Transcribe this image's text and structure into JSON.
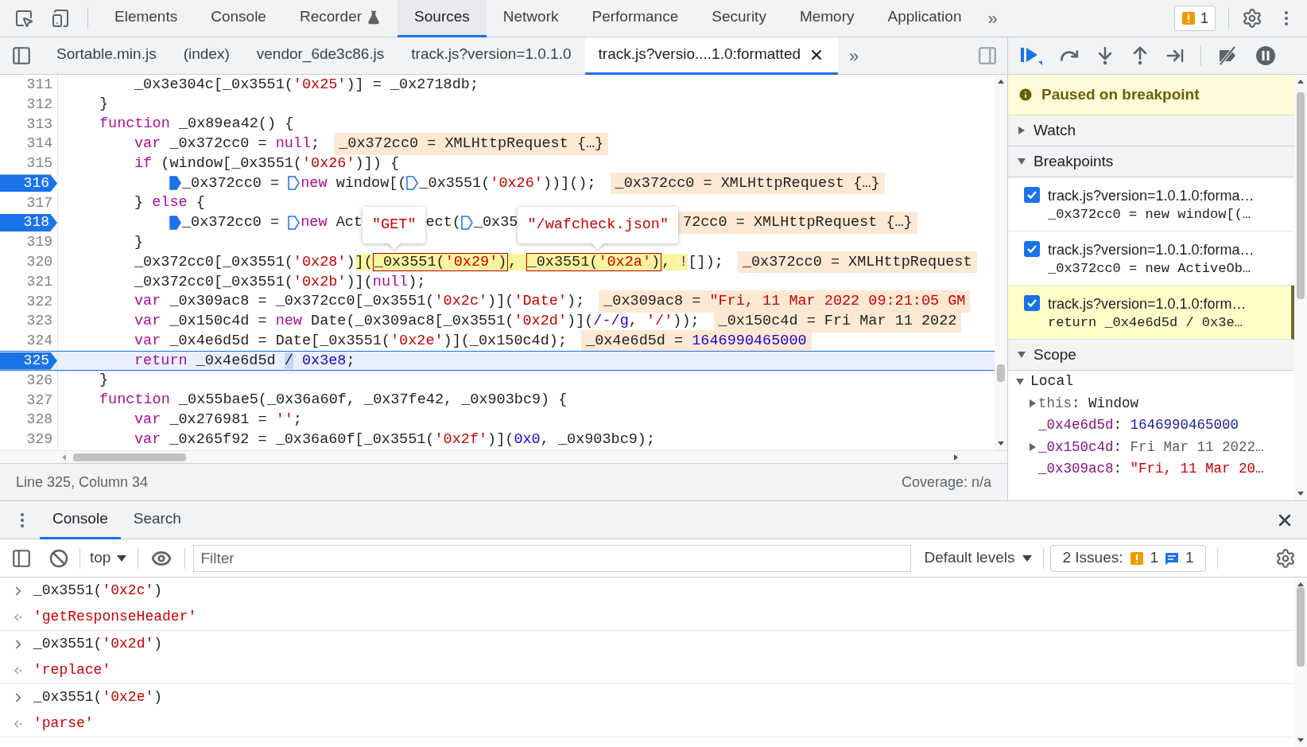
{
  "top_tabs": [
    {
      "label": "Elements",
      "selected": false,
      "experimental": false
    },
    {
      "label": "Console",
      "selected": false,
      "experimental": false
    },
    {
      "label": "Recorder",
      "selected": false,
      "experimental": true
    },
    {
      "label": "Sources",
      "selected": true,
      "experimental": false
    },
    {
      "label": "Network",
      "selected": false,
      "experimental": false
    },
    {
      "label": "Performance",
      "selected": false,
      "experimental": false
    },
    {
      "label": "Security",
      "selected": false,
      "experimental": false
    },
    {
      "label": "Memory",
      "selected": false,
      "experimental": false
    },
    {
      "label": "Application",
      "selected": false,
      "experimental": false
    }
  ],
  "more_tabs": "»",
  "issues_badge": "1",
  "file_tabs": [
    {
      "label": "Sortable.min.js",
      "selected": false,
      "closable": false
    },
    {
      "label": "(index)",
      "selected": false,
      "closable": false
    },
    {
      "label": "vendor_6de3c86.js",
      "selected": false,
      "closable": false
    },
    {
      "label": "track.js?version=1.0.1.0",
      "selected": false,
      "closable": false
    },
    {
      "label": "track.js?versio....1.0:formatted",
      "selected": true,
      "closable": true
    }
  ],
  "file_tabs_more": "»",
  "code": {
    "lines": [
      {
        "kind": "block",
        "children": [
          {
            "kind": "block",
            "children": [
              {
                "kind": "line",
                "number": "311",
                "breakpoint": false,
                "current": false,
                "segments": [
                  {
                    "kind": "code",
                    "tokens": [
                      {
                        "t": "_0x3e304c[_0x3551("
                      },
                      {
                        "t": "'0x25'",
                        "kind": "str"
                      },
                      {
                        "t": ")] = _0x2718db;"
                      }
                    ]
                  }
                ]
              }
            ]
          },
          {
            "kind": "line",
            "number": "312",
            "breakpoint": false,
            "current": false,
            "segments": [
              {
                "kind": "code",
                "tokens": [
                  {
                    "t": "}"
                  }
                ]
              }
            ]
          },
          {
            "kind": "line",
            "number": "313",
            "breakpoint": false,
            "current": false,
            "segments": [
              {
                "kind": "code",
                "tokens": [
                  {
                    "t": "function",
                    "kind": "kw"
                  },
                  {
                    "t": " _0x89ea42() {"
                  }
                ]
              }
            ],
            "children": [
              {
                "kind": "line",
                "number": "314",
                "breakpoint": false,
                "current": false,
                "segments": [
                  {
                    "kind": "code",
                    "tokens": [
                      {
                        "t": "var",
                        "kind": "kw"
                      },
                      {
                        "t": " _0x372cc0 = "
                      },
                      {
                        "t": "null",
                        "kind": "kw"
                      },
                      {
                        "t": ";"
                      }
                    ]
                  },
                  {
                    "kind": "inline",
                    "tokens": [
                      {
                        "t": "_0x372cc0 = XMLHttpRequest {…}"
                      }
                    ]
                  }
                ]
              },
              {
                "kind": "line",
                "number": "315",
                "breakpoint": false,
                "current": false,
                "segments": [
                  {
                    "kind": "code",
                    "tokens": [
                      {
                        "t": "if",
                        "kind": "kw"
                      },
                      {
                        "t": " (window[_0x3551("
                      },
                      {
                        "t": "'0x26'",
                        "kind": "str"
                      },
                      {
                        "t": ")]) {"
                      }
                    ]
                  }
                ],
                "children": [
                  {
                    "kind": "line",
                    "number": "316",
                    "breakpoint": true,
                    "current": false,
                    "segments": [
                      {
                        "kind": "marker",
                        "active": true
                      },
                      {
                        "kind": "code",
                        "tokens": [
                          {
                            "t": "_0x372cc0 = "
                          }
                        ]
                      },
                      {
                        "kind": "marker",
                        "active": false
                      },
                      {
                        "kind": "code",
                        "tokens": [
                          {
                            "t": "new",
                            "kind": "kw"
                          },
                          {
                            "t": " window[("
                          }
                        ]
                      },
                      {
                        "kind": "marker",
                        "active": false
                      },
                      {
                        "kind": "code",
                        "tokens": [
                          {
                            "t": "_0x3551("
                          },
                          {
                            "t": "'0x26'",
                            "kind": "str"
                          },
                          {
                            "t": "))]();"
                          }
                        ]
                      },
                      {
                        "kind": "inline",
                        "tokens": [
                          {
                            "t": "_0x372cc0 = XMLHttpRequest {…}"
                          }
                        ]
                      }
                    ]
                  }
                ]
              },
              {
                "kind": "line",
                "number": "317",
                "breakpoint": false,
                "current": false,
                "segments": [
                  {
                    "kind": "code",
                    "tokens": [
                      {
                        "t": "} "
                      },
                      {
                        "t": "else",
                        "kind": "kw"
                      },
                      {
                        "t": " {"
                      }
                    ]
                  }
                ],
                "children": [
                  {
                    "kind": "line",
                    "number": "318",
                    "breakpoint": true,
                    "current": false,
                    "segments": [
                      {
                        "kind": "marker",
                        "active": true
                      },
                      {
                        "kind": "code",
                        "tokens": [
                          {
                            "t": "_0x372cc0 = "
                          }
                        ]
                      },
                      {
                        "kind": "marker",
                        "active": false
                      },
                      {
                        "kind": "code",
                        "tokens": [
                          {
                            "t": "new",
                            "kind": "kw"
                          },
                          {
                            "t": " Act"
                          }
                        ]
                      },
                      {
                        "kind": "popover",
                        "text": "\"GET\""
                      },
                      {
                        "kind": "code",
                        "tokens": [
                          {
                            "t": "ect("
                          }
                        ]
                      },
                      {
                        "kind": "marker",
                        "active": false
                      },
                      {
                        "kind": "code",
                        "tokens": [
                          {
                            "t": "_0x35"
                          }
                        ]
                      },
                      {
                        "kind": "popover",
                        "text": "\"/wafcheck.json\""
                      },
                      {
                        "kind": "inline",
                        "tokens": [
                          {
                            "t": "72cc0 = XMLHttpRequest {…}"
                          }
                        ]
                      }
                    ]
                  }
                ]
              },
              {
                "kind": "line",
                "number": "319",
                "breakpoint": false,
                "current": false,
                "segments": [
                  {
                    "kind": "code",
                    "tokens": [
                      {
                        "t": "}"
                      }
                    ]
                  }
                ]
              },
              {
                "kind": "line",
                "number": "320",
                "breakpoint": false,
                "current": false,
                "segments": [
                  {
                    "kind": "code",
                    "tokens": [
                      {
                        "t": "_0x372cc0[_0x3551("
                      },
                      {
                        "t": "'0x28'",
                        "kind": "str"
                      },
                      {
                        "t": ")"
                      },
                      {
                        "t": "](",
                        "highlighted": true
                      },
                      {
                        "kind": "group",
                        "boxed": true,
                        "tokens": [
                          {
                            "t": "_0x3551("
                          },
                          {
                            "t": "'0x29'",
                            "kind": "str"
                          },
                          {
                            "t": ")"
                          }
                        ]
                      },
                      {
                        "t": ", ",
                        "highlighted": true
                      },
                      {
                        "kind": "group",
                        "boxed": true,
                        "tokens": [
                          {
                            "t": "_0x3551("
                          },
                          {
                            "t": "'0x2a'",
                            "kind": "str"
                          },
                          {
                            "t": ")"
                          }
                        ]
                      },
                      {
                        "t": ", ",
                        "highlighted": true
                      },
                      {
                        "t": "!",
                        "kind": "kw",
                        "highlighted": true
                      },
                      {
                        "t": "[]);"
                      }
                    ]
                  },
                  {
                    "kind": "inline",
                    "tokens": [
                      {
                        "t": "_0x372cc0 = XMLHttpRequest"
                      }
                    ]
                  }
                ]
              },
              {
                "kind": "line",
                "number": "321",
                "breakpoint": false,
                "current": false,
                "segments": [
                  {
                    "kind": "code",
                    "tokens": [
                      {
                        "t": "_0x372cc0[_0x3551("
                      },
                      {
                        "t": "'0x2b'",
                        "kind": "str"
                      },
                      {
                        "t": ")]("
                      },
                      {
                        "t": "null",
                        "kind": "kw"
                      },
                      {
                        "t": ");"
                      }
                    ]
                  }
                ]
              },
              {
                "kind": "line",
                "number": "322",
                "breakpoint": false,
                "current": false,
                "segments": [
                  {
                    "kind": "code",
                    "tokens": [
                      {
                        "t": "var",
                        "kind": "kw"
                      },
                      {
                        "t": " _0x309ac8 = _0x372cc0[_0x3551("
                      },
                      {
                        "t": "'0x2c'",
                        "kind": "str"
                      },
                      {
                        "t": ")]("
                      },
                      {
                        "t": "'Date'",
                        "kind": "str"
                      },
                      {
                        "t": ");"
                      }
                    ]
                  },
                  {
                    "kind": "inline",
                    "tokens": [
                      {
                        "t": "_0x309ac8 = "
                      },
                      {
                        "t": "\"Fri, 11 Mar 2022 09:21:05 GM",
                        "kind": "str"
                      }
                    ]
                  }
                ]
              },
              {
                "kind": "line",
                "number": "323",
                "breakpoint": false,
                "current": false,
                "segments": [
                  {
                    "kind": "code",
                    "tokens": [
                      {
                        "t": "var",
                        "kind": "kw"
                      },
                      {
                        "t": " _0x150c4d = "
                      },
                      {
                        "t": "new",
                        "kind": "kw"
                      },
                      {
                        "t": " Date(_0x309ac8[_0x3551("
                      },
                      {
                        "t": "'0x2d'",
                        "kind": "str"
                      },
                      {
                        "t": ")]("
                      },
                      {
                        "t": "/-/g",
                        "kind": "num"
                      },
                      {
                        "t": ", "
                      },
                      {
                        "t": "'/'",
                        "kind": "str"
                      },
                      {
                        "t": "));"
                      }
                    ]
                  },
                  {
                    "kind": "inline",
                    "tokens": [
                      {
                        "t": "_0x150c4d = Fri Mar 11 2022"
                      }
                    ]
                  }
                ]
              },
              {
                "kind": "line",
                "number": "324",
                "breakpoint": false,
                "current": false,
                "segments": [
                  {
                    "kind": "code",
                    "tokens": [
                      {
                        "t": "var",
                        "kind": "kw"
                      },
                      {
                        "t": " _0x4e6d5d = Date[_0x3551("
                      },
                      {
                        "t": "'0x2e'",
                        "kind": "str"
                      },
                      {
                        "t": ")](_0x150c4d);"
                      }
                    ]
                  },
                  {
                    "kind": "inline",
                    "tokens": [
                      {
                        "t": "_0x4e6d5d = "
                      },
                      {
                        "t": "1646990465000",
                        "kind": "num"
                      }
                    ]
                  }
                ]
              },
              {
                "kind": "line",
                "number": "325",
                "breakpoint": true,
                "current": true,
                "segments": [
                  {
                    "kind": "code",
                    "tokens": [
                      {
                        "t": "return",
                        "kind": "kw"
                      },
                      {
                        "t": " _0x4e6d5d "
                      },
                      {
                        "t": "/",
                        "caret": true
                      },
                      {
                        "t": " 0x3e8",
                        "kind": "num"
                      },
                      {
                        "t": ";"
                      }
                    ]
                  }
                ]
              }
            ]
          },
          {
            "kind": "line",
            "number": "326",
            "breakpoint": false,
            "current": false,
            "segments": [
              {
                "kind": "code",
                "tokens": [
                  {
                    "t": "}"
                  }
                ]
              }
            ]
          },
          {
            "kind": "line",
            "number": "327",
            "breakpoint": false,
            "current": false,
            "segments": [
              {
                "kind": "code",
                "tokens": [
                  {
                    "t": "function",
                    "kind": "kw"
                  },
                  {
                    "t": " _0x55bae5(_0x36a60f, _0x37fe42, _0x903bc9) {"
                  }
                ]
              }
            ],
            "children": [
              {
                "kind": "line",
                "number": "328",
                "breakpoint": false,
                "current": false,
                "segments": [
                  {
                    "kind": "code",
                    "tokens": [
                      {
                        "t": "var",
                        "kind": "kw"
                      },
                      {
                        "t": " _0x276981 = "
                      },
                      {
                        "t": "''",
                        "kind": "str"
                      },
                      {
                        "t": ";"
                      }
                    ]
                  }
                ]
              },
              {
                "kind": "line",
                "number": "329",
                "breakpoint": false,
                "current": false,
                "segments": [
                  {
                    "kind": "code",
                    "tokens": [
                      {
                        "t": "var",
                        "kind": "kw"
                      },
                      {
                        "t": " _0x265f92 = _0x36a60f[_0x3551("
                      },
                      {
                        "t": "'0x2f'",
                        "kind": "str"
                      },
                      {
                        "t": ")]("
                      },
                      {
                        "t": "0x0",
                        "kind": "num"
                      },
                      {
                        "t": ", _0x903bc9);"
                      }
                    ]
                  }
                ]
              }
            ]
          }
        ]
      }
    ]
  },
  "status": {
    "position": "Line 325, Column 34",
    "coverage": "Coverage: n/a"
  },
  "debugger": {
    "paused_message": "Paused on breakpoint",
    "sections": [
      {
        "kind": "watch",
        "title": "Watch",
        "expanded": false
      },
      {
        "kind": "breakpoints",
        "title": "Breakpoints",
        "expanded": true,
        "items": [
          {
            "file": "track.js?version=1.0.1.0:forma…",
            "code": "_0x372cc0 = new window[(…",
            "checked": true,
            "selected": false
          },
          {
            "file": "track.js?version=1.0.1.0:forma…",
            "code": "_0x372cc0 = new ActiveOb…",
            "checked": true,
            "selected": false
          },
          {
            "file": "track.js?version=1.0.1.0:form…",
            "code": "return _0x4e6d5d / 0x3e…",
            "checked": true,
            "selected": true
          }
        ]
      },
      {
        "kind": "scope",
        "title": "Scope",
        "expanded": true,
        "scopes": [
          {
            "title": "Local",
            "expanded": true,
            "children": [
              {
                "name": "this",
                "separator": ":",
                "builtin": true,
                "value": "Window",
                "kind": "object",
                "expandable": true
              },
              {
                "name": "_0x4e6d5d",
                "separator": ":",
                "builtin": false,
                "value": "1646990465000",
                "kind": "number",
                "expandable": false
              },
              {
                "name": "_0x150c4d",
                "separator": ":",
                "builtin": false,
                "value": "Fri Mar 11 2022…",
                "kind": "date",
                "expandable": true
              },
              {
                "name": "_0x309ac8",
                "separator": ":",
                "builtin": false,
                "value": "\"Fri, 11 Mar 20…",
                "kind": "string",
                "expandable": false
              }
            ]
          }
        ]
      }
    ]
  },
  "drawer": {
    "tabs": [
      {
        "label": "Console",
        "selected": true
      },
      {
        "label": "Search",
        "selected": false
      }
    ],
    "context": "top",
    "filter_placeholder": "Filter",
    "levels": "Default levels",
    "issues_label": "2 Issues:",
    "warnings": "1",
    "infos": "1",
    "entries": [
      {
        "kind": "input",
        "tokens": [
          {
            "t": "_0x3551("
          },
          {
            "t": "'0x2c'",
            "kind": "str"
          },
          {
            "t": ")"
          }
        ]
      },
      {
        "kind": "output",
        "tokens": [
          {
            "t": "'getResponseHeader'",
            "kind": "str"
          }
        ]
      },
      {
        "kind": "input",
        "tokens": [
          {
            "t": "_0x3551("
          },
          {
            "t": "'0x2d'",
            "kind": "str"
          },
          {
            "t": ")"
          }
        ]
      },
      {
        "kind": "output",
        "tokens": [
          {
            "t": "'replace'",
            "kind": "str"
          }
        ]
      },
      {
        "kind": "input",
        "tokens": [
          {
            "t": "_0x3551("
          },
          {
            "t": "'0x2e'",
            "kind": "str"
          },
          {
            "t": ")"
          }
        ]
      },
      {
        "kind": "output",
        "tokens": [
          {
            "t": "'parse'",
            "kind": "str"
          }
        ]
      }
    ]
  }
}
